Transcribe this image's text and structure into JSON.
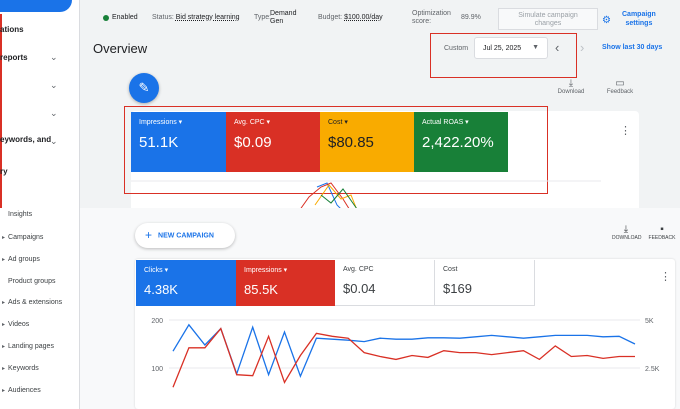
{
  "top_sidebar": {
    "items": [
      {
        "label": "ations",
        "chevron": false
      },
      {
        "label": "reports",
        "chevron": true
      },
      {
        "label": "",
        "chevron": true
      },
      {
        "label": "",
        "chevron": true
      },
      {
        "label": "eywords, and",
        "chevron": true
      },
      {
        "label": "ry",
        "chevron": false
      }
    ]
  },
  "status_bar": {
    "enabled": "Enabled",
    "status_label": "Status:",
    "status_value": "Bid strategy learning",
    "type_label": "Type:",
    "type_value_1": "Demand",
    "type_value_2": "Gen",
    "budget_label": "Budget:",
    "budget_value": "$100.00/day",
    "opt_label_1": "Optimization",
    "opt_label_2": "score:",
    "opt_value": "89.9%",
    "simulate_1": "Simulate campaign",
    "simulate_2": "changes",
    "settings_1": "Campaign",
    "settings_2": "settings"
  },
  "overview": {
    "title": "Overview",
    "date_label": "Custom",
    "date_value": "Jul 25, 2025",
    "show_last": "Show last 30 days",
    "download": "Download",
    "feedback": "Feedback"
  },
  "top_metrics": [
    {
      "label": "Impressions ▾",
      "value": "51.1K",
      "color": "#1a73e8"
    },
    {
      "label": "Avg. CPC ▾",
      "value": "$0.09",
      "color": "#d93025"
    },
    {
      "label": "Cost ▾",
      "value": "$80.85",
      "color": "#f9ab00"
    },
    {
      "label": "Actual ROAS ▾",
      "value": "2,422.20%",
      "color": "#188038"
    }
  ],
  "bottom_sidebar": {
    "items": [
      {
        "label": "Insights",
        "arrow": false
      },
      {
        "label": "Campaigns",
        "arrow": true
      },
      {
        "label": "Ad groups",
        "arrow": true
      },
      {
        "label": "Product groups",
        "arrow": false
      },
      {
        "label": "Ads & extensions",
        "arrow": true
      },
      {
        "label": "Videos",
        "arrow": true
      },
      {
        "label": "Landing pages",
        "arrow": true
      },
      {
        "label": "Keywords",
        "arrow": true
      },
      {
        "label": "Audiences",
        "arrow": true
      }
    ]
  },
  "bottom": {
    "new_campaign": "NEW CAMPAIGN",
    "download": "DOWNLOAD",
    "feedback": "FEEDBACK"
  },
  "bottom_metrics": [
    {
      "label": "Clicks ▾",
      "value": "4.38K",
      "color": "#1a73e8",
      "style": "filled"
    },
    {
      "label": "Impressions ▾",
      "value": "85.5K",
      "color": "#d93025",
      "style": "filled"
    },
    {
      "label": "Avg. CPC",
      "value": "$0.04",
      "color": "#ffffff",
      "style": "plain"
    },
    {
      "label": "Cost",
      "value": "$169",
      "color": "#ffffff",
      "style": "plain"
    }
  ],
  "chart_data": {
    "type": "line",
    "ylabel_left_ticks": [
      "200",
      "100"
    ],
    "ylabel_right_ticks": [
      "5K",
      "2.5K"
    ],
    "ylim_left": [
      50,
      200
    ],
    "ylim_right": [
      1250,
      5000
    ],
    "series": [
      {
        "name": "Clicks",
        "color": "#1a73e8",
        "axis": "left",
        "values": [
          135,
          190,
          148,
          182,
          88,
          185,
          86,
          175,
          83,
          162,
          160,
          158,
          155,
          162,
          160,
          160,
          163,
          163,
          162,
          165,
          168,
          165,
          162,
          165,
          168,
          168,
          168,
          165,
          166,
          150
        ]
      },
      {
        "name": "Impressions",
        "color": "#d93025",
        "axis": "right",
        "values": [
          1500,
          3550,
          3550,
          4550,
          2150,
          2100,
          4150,
          1750,
          3150,
          4300,
          4150,
          4050,
          3300,
          3100,
          2950,
          3150,
          3050,
          3400,
          3300,
          3300,
          3200,
          3300,
          3400,
          2950,
          3650,
          3100,
          3150,
          3000,
          3100,
          3100
        ]
      }
    ]
  }
}
